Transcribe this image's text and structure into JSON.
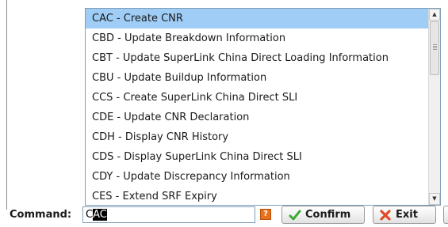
{
  "dropdown": {
    "options": [
      "CAC - Create CNR",
      "CBD - Update Breakdown Information",
      "CBT - Update SuperLink China Direct Loading Information",
      "CBU - Update Buildup Information",
      "CCS - Create SuperLink China Direct SLI",
      "CDE - Update CNR Declaration",
      "CDH - Display CNR History",
      "CDS - Display SuperLink China Direct SLI",
      "CDY - Update Discrepancy Information",
      "CES - Extend SRF Expiry"
    ],
    "selected_index": 0,
    "scroll_up_glyph": "▲",
    "scroll_down_glyph": "▼"
  },
  "command": {
    "label": "Command:",
    "typed_text": "C",
    "selected_text": "AC"
  },
  "help_icon": {
    "glyph": "?",
    "color": "#e8701a"
  },
  "buttons": {
    "confirm_label": "Confirm",
    "exit_label": "Exit"
  },
  "colors": {
    "selection_highlight": "#9fcdf5",
    "confirm_icon": "#3da832",
    "exit_icon": "#e04a2a"
  },
  "icons": {
    "confirm": "check-icon",
    "exit": "x-icon",
    "help": "help-icon"
  }
}
